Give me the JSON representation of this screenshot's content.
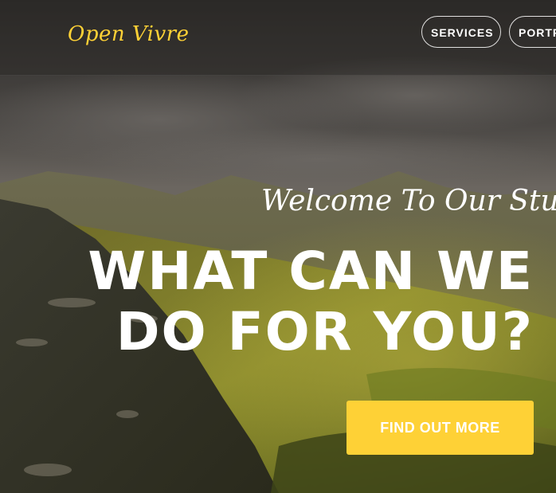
{
  "brand": {
    "name": "Open Vivre",
    "color": "#fed136"
  },
  "nav": {
    "items": [
      {
        "label": "SERVICES"
      },
      {
        "label": "PORTFOLIO"
      }
    ]
  },
  "hero": {
    "welcome": "Welcome To Our Studio!",
    "headline": "WHAT CAN WE DO FOR YOU?",
    "cta_label": "FIND OUT MORE",
    "cta_color": "#fed136"
  }
}
